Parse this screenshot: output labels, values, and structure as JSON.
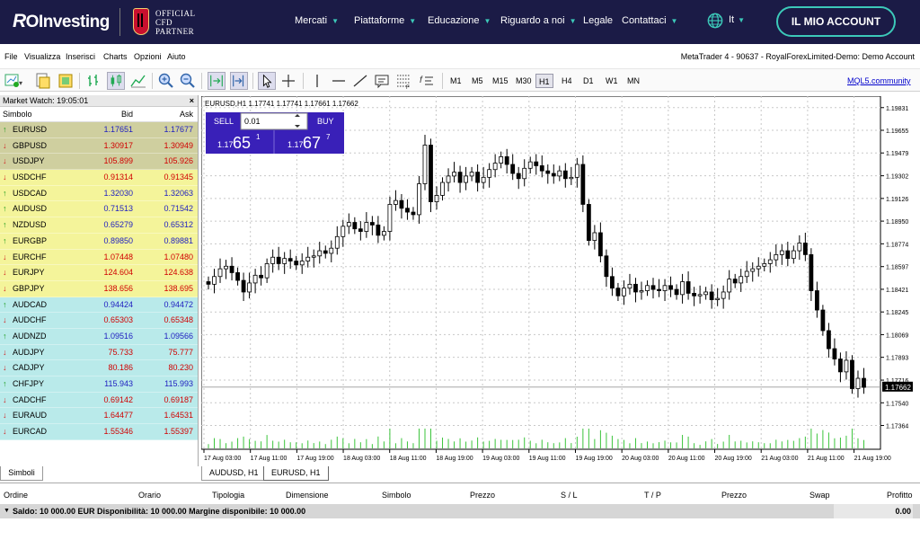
{
  "nav": {
    "brand": "Investing",
    "brand_ro": "R",
    "partner": [
      "OFFICIAL",
      "CFD",
      "PARTNER"
    ],
    "items": [
      {
        "label": "Mercati",
        "caret": true
      },
      {
        "label": "Piattaforme",
        "caret": true
      },
      {
        "label": "Educazione",
        "caret": true
      },
      {
        "label": "Riguardo a noi",
        "caret": true
      },
      {
        "label": "Legale",
        "caret": false
      },
      {
        "label": "Contattaci",
        "caret": true
      }
    ],
    "lang": "It",
    "account_button": "IL MIO ACCOUNT",
    "accent": "#3cc9b9",
    "bg": "#1b1b46"
  },
  "menubar": {
    "items": [
      "File",
      "Visualizza",
      "Inserisci",
      "Charts",
      "Opzioni",
      "Aiuto"
    ],
    "title": "MetaTrader 4 - 90637 - RoyalForexLimited-Demo: Demo Account"
  },
  "toolbar": {
    "timeframes": [
      "M1",
      "M5",
      "M15",
      "M30",
      "H1",
      "H4",
      "D1",
      "W1",
      "MN"
    ],
    "selected_timeframe": "H1",
    "mql": "MQL5.community"
  },
  "market_watch": {
    "title": "Market Watch: 19:05:01",
    "col_symbol": "Simbolo",
    "col_bid": "Bid",
    "col_ask": "Ask",
    "rows": [
      {
        "sym": "EURUSD",
        "bid": "1.17651",
        "ask": "1.17677",
        "dir": "up"
      },
      {
        "sym": "GBPUSD",
        "bid": "1.30917",
        "ask": "1.30949",
        "dir": "down"
      },
      {
        "sym": "USDJPY",
        "bid": "105.899",
        "ask": "105.926",
        "dir": "down"
      },
      {
        "sym": "USDCHF",
        "bid": "0.91314",
        "ask": "0.91345",
        "dir": "down"
      },
      {
        "sym": "USDCAD",
        "bid": "1.32030",
        "ask": "1.32063",
        "dir": "up"
      },
      {
        "sym": "AUDUSD",
        "bid": "0.71513",
        "ask": "0.71542",
        "dir": "up"
      },
      {
        "sym": "NZDUSD",
        "bid": "0.65279",
        "ask": "0.65312",
        "dir": "up"
      },
      {
        "sym": "EURGBP",
        "bid": "0.89850",
        "ask": "0.89881",
        "dir": "up"
      },
      {
        "sym": "EURCHF",
        "bid": "1.07448",
        "ask": "1.07480",
        "dir": "down"
      },
      {
        "sym": "EURJPY",
        "bid": "124.604",
        "ask": "124.638",
        "dir": "down"
      },
      {
        "sym": "GBPJPY",
        "bid": "138.656",
        "ask": "138.695",
        "dir": "down"
      },
      {
        "sym": "AUDCAD",
        "bid": "0.94424",
        "ask": "0.94472",
        "dir": "up"
      },
      {
        "sym": "AUDCHF",
        "bid": "0.65303",
        "ask": "0.65348",
        "dir": "down"
      },
      {
        "sym": "AUDNZD",
        "bid": "1.09516",
        "ask": "1.09566",
        "dir": "up"
      },
      {
        "sym": "AUDJPY",
        "bid": "75.733",
        "ask": "75.777",
        "dir": "down"
      },
      {
        "sym": "CADJPY",
        "bid": "80.186",
        "ask": "80.230",
        "dir": "down"
      },
      {
        "sym": "CHFJPY",
        "bid": "115.943",
        "ask": "115.993",
        "dir": "up"
      },
      {
        "sym": "CADCHF",
        "bid": "0.69142",
        "ask": "0.69187",
        "dir": "down"
      },
      {
        "sym": "EURAUD",
        "bid": "1.64477",
        "ask": "1.64531",
        "dir": "down"
      },
      {
        "sym": "EURCAD",
        "bid": "1.55346",
        "ask": "1.55397",
        "dir": "down"
      }
    ],
    "tab": "Simboli"
  },
  "chart": {
    "header": "EURUSD,H1  1.17741 1.17741 1.17661 1.17662",
    "sell_label": "SELL",
    "buy_label": "BUY",
    "lot": "0.01",
    "sell_price_small": "1.17",
    "sell_price_big": "65",
    "sell_price_sup": "1",
    "buy_price_small": "1.17",
    "buy_price_big": "67",
    "buy_price_sup": "7",
    "current_price": "1.17662",
    "tabs": [
      "AUDUSD, H1",
      "EURUSD, H1"
    ],
    "active_tab": 1
  },
  "chart_data": {
    "type": "candlestick",
    "title": "EURUSD,H1",
    "y_ticks": [
      "1.19831",
      "1.19655",
      "1.19479",
      "1.19302",
      "1.19126",
      "1.18950",
      "1.18774",
      "1.18597",
      "1.18421",
      "1.18245",
      "1.18069",
      "1.17893",
      "1.17716",
      "1.17540",
      "1.17364"
    ],
    "x_ticks": [
      "17 Aug 03:00",
      "17 Aug 11:00",
      "17 Aug 19:00",
      "18 Aug 03:00",
      "18 Aug 11:00",
      "18 Aug 19:00",
      "19 Aug 03:00",
      "19 Aug 11:00",
      "19 Aug 19:00",
      "20 Aug 03:00",
      "20 Aug 11:00",
      "20 Aug 19:00",
      "21 Aug 03:00",
      "21 Aug 11:00",
      "21 Aug 19:00"
    ],
    "ylim": [
      1.1727,
      1.1992
    ],
    "grid": true,
    "closes": [
      1.1846,
      1.1852,
      1.1858,
      1.186,
      1.1855,
      1.1849,
      1.184,
      1.1847,
      1.1853,
      1.1851,
      1.1862,
      1.1867,
      1.1862,
      1.1866,
      1.1864,
      1.1861,
      1.1864,
      1.1867,
      1.1868,
      1.1872,
      1.187,
      1.1874,
      1.1883,
      1.1891,
      1.1894,
      1.1889,
      1.1887,
      1.1894,
      1.1892,
      1.1884,
      1.1887,
      1.1908,
      1.1911,
      1.1905,
      1.1902,
      1.19,
      1.1924,
      1.1954,
      1.191,
      1.1915,
      1.1925,
      1.193,
      1.1933,
      1.1925,
      1.193,
      1.1933,
      1.1925,
      1.1929,
      1.1935,
      1.194,
      1.1945,
      1.1939,
      1.1932,
      1.1928,
      1.1936,
      1.1941,
      1.1938,
      1.1934,
      1.1932,
      1.193,
      1.1934,
      1.1928,
      1.1929,
      1.1939,
      1.1908,
      1.188,
      1.1886,
      1.1868,
      1.1852,
      1.1843,
      1.1837,
      1.1843,
      1.1846,
      1.184,
      1.1841,
      1.1845,
      1.1842,
      1.1841,
      1.1845,
      1.1842,
      1.1838,
      1.1848,
      1.1839,
      1.1837,
      1.1838,
      1.184,
      1.1834,
      1.1835,
      1.184,
      1.185,
      1.1847,
      1.1852,
      1.1856,
      1.1858,
      1.186,
      1.1862,
      1.1865,
      1.1869,
      1.1872,
      1.1866,
      1.1872,
      1.1878,
      1.1869,
      1.1841,
      1.1826,
      1.181,
      1.1796,
      1.1788,
      1.1778,
      1.1787,
      1.1765,
      1.1773,
      1.1766
    ],
    "current": 1.17662
  },
  "terminal": {
    "headers": [
      "Ordine",
      "Orario",
      "Tipologia",
      "Dimensione",
      "Simbolo",
      "Prezzo",
      "S / L",
      "T / P",
      "Prezzo",
      "Swap",
      "Profitto"
    ],
    "summary": "Saldo: 10 000.00 EUR  Disponibilità: 10 000.00  Margine disponibile: 10 000.00",
    "profit": "0.00"
  }
}
